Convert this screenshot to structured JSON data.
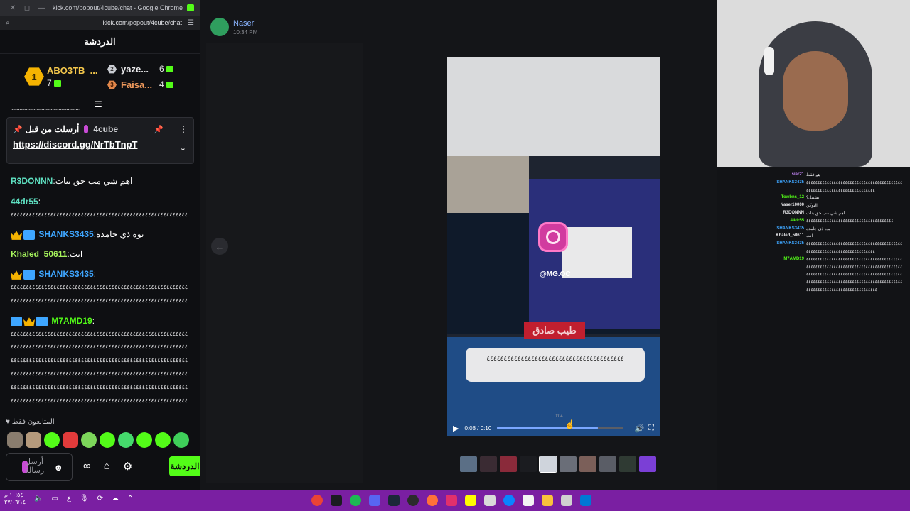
{
  "chrome": {
    "title": "kick.com/popout/4cube/chat - Google Chrome",
    "url": "kick.com/popout/4cube/chat",
    "controls": [
      "✕",
      "◻",
      "—"
    ]
  },
  "chat": {
    "header": "الدردشة",
    "leaderboard": [
      {
        "rank": "1",
        "name": "ABO3TB_...",
        "count": "7"
      },
      {
        "rank": "2",
        "name": "yaze...",
        "count": "6"
      },
      {
        "rank": "3",
        "name": "Faisa...",
        "count": "4"
      }
    ],
    "dots": "\"\"\"\"\"\"\"\"\"\"\"\"\"\"\"\"\"\"\"\"\"\"\"\"\"\"\"\"\"\"\"\"\"\"\"\"\"\"\"\"\"\"\"\"\"\"\"\"\"\"\"\"",
    "pinned": {
      "sent_by": "أرسلت من قبل",
      "author": "4cube",
      "link": "https://discord.gg/NrTbTnpT"
    },
    "messages": [
      {
        "user": "R3DONNN",
        "text": ":اهم شي مب حق بنات"
      },
      {
        "user": "44dr55",
        "text": ":"
      },
      {
        "user": "SHANKS3435",
        "text": ":يوه ذي جامده"
      },
      {
        "user": "Khaled_50611",
        "text": ":انت"
      },
      {
        "user": "SHANKS3435",
        "text": ":"
      },
      {
        "user": "M7AMD19",
        "text": ":"
      }
    ],
    "filler": "٤٤٤٤٤٤٤٤٤٤٤٤٤٤٤٤٤٤٤٤٤٤٤٤٤٤٤٤٤٤٤٤٤٤٤٤٤٤٤٤٤٤٤٤٤٤٤٤٤٤٤٤٤٤٤٤٤٤٤٤٤٤٤٤",
    "followers_only": "المتابعون فقط",
    "input_placeholder": "أرسل رسالة",
    "send_label": "الدردشة"
  },
  "discord": {
    "author": "Naser",
    "time": "10:34 PM"
  },
  "video": {
    "handle": "@MG.OC",
    "red_label": "طيب صادق",
    "bubble_text": "٤٤٤٤٤٤٤٤٤٤٤٤٤٤٤٤٤٤٤٤٤٤٤٤٤٤٤٤٤٤٤٤٤٤٤٤٤٤٤٤",
    "time": "0:08 / 0:10",
    "hover_time": "0:04",
    "progress": 0.8
  },
  "overlay_chat": [
    {
      "user": "siar21",
      "text": "هو فقط",
      "color": "#c989ff"
    },
    {
      "user": "SHANKS3435",
      "text": "٤٤٤٤٤٤٤٤٤٤٤٤٤٤٤٤٤٤٤٤٤٤٤٤٤٤٤٤٤٤٤٤٤٤٤٤٤٤٤٤٤٤",
      "color": "#3ea6ff"
    },
    {
      "user": "",
      "text": "٤٤٤٤٤٤٤٤٤٤٤٤٤٤٤٤٤٤٤٤٤٤٤٤٤٤٤٤٤٤",
      "color": "#e7e7ea"
    },
    {
      "user": "Towbns_12",
      "text": "تشتبل؟",
      "color": "#53fc18"
    },
    {
      "user": "Naser10000",
      "text": "اليوكن",
      "color": "#e7e7ea"
    },
    {
      "user": "R3DONNN",
      "text": "اهم شي مب حق بنات",
      "color": "#e7e7ea"
    },
    {
      "user": "44dr55",
      "text": "٤٤٤٤٤٤٤٤٤٤٤٤٤٤٤٤٤٤٤٤٤٤٤٤٤٤٤٤٤٤٤٤٤٤٤٤٤٤",
      "color": "#53fc18"
    },
    {
      "user": "SHANKS3435",
      "text": "يوه ذي جامده",
      "color": "#3ea6ff"
    },
    {
      "user": "Khaled_50611",
      "text": "انت",
      "color": "#e7e7ea"
    },
    {
      "user": "SHANKS3435",
      "text": "٤٤٤٤٤٤٤٤٤٤٤٤٤٤٤٤٤٤٤٤٤٤٤٤٤٤٤٤٤٤٤٤٤٤٤٤٤٤٤٤٤٤",
      "color": "#3ea6ff"
    },
    {
      "user": "",
      "text": "٤٤٤٤٤٤٤٤٤٤٤٤٤٤٤٤٤٤٤٤٤٤٤٤٤٤٤٤٤٤",
      "color": "#e7e7ea"
    },
    {
      "user": "M7AMD19",
      "text": "٤٤٤٤٤٤٤٤٤٤٤٤٤٤٤٤٤٤٤٤٤٤٤٤٤٤٤٤٤٤٤٤٤٤٤٤٤٤٤٤٤٤",
      "color": "#53fc18"
    },
    {
      "user": "",
      "text": "٤٤٤٤٤٤٤٤٤٤٤٤٤٤٤٤٤٤٤٤٤٤٤٤٤٤٤٤٤٤٤٤٤٤٤٤٤٤٤٤٤٤",
      "color": "#e7e7ea"
    },
    {
      "user": "",
      "text": "٤٤٤٤٤٤٤٤٤٤٤٤٤٤٤٤٤٤٤٤٤٤٤٤٤٤٤٤٤٤٤٤٤٤٤٤٤٤٤٤٤٤",
      "color": "#e7e7ea"
    },
    {
      "user": "",
      "text": "٤٤٤٤٤٤٤٤٤٤٤٤٤٤٤٤٤٤٤٤٤٤٤٤٤٤٤٤٤٤٤٤٤٤٤٤٤٤٤٤٤٤",
      "color": "#e7e7ea"
    },
    {
      "user": "",
      "text": "٤٤٤٤٤٤٤٤٤٤٤٤٤٤٤٤٤٤٤٤٤٤٤٤٤٤٤٤٤٤٤",
      "color": "#e7e7ea"
    }
  ],
  "taskbar": {
    "clock_time": "١٠:٥٤ م",
    "clock_date": "٢٧/٠٦/١٤"
  },
  "colors": {
    "kick_green": "#53fc18",
    "taskbar": "#7a1fa2"
  }
}
